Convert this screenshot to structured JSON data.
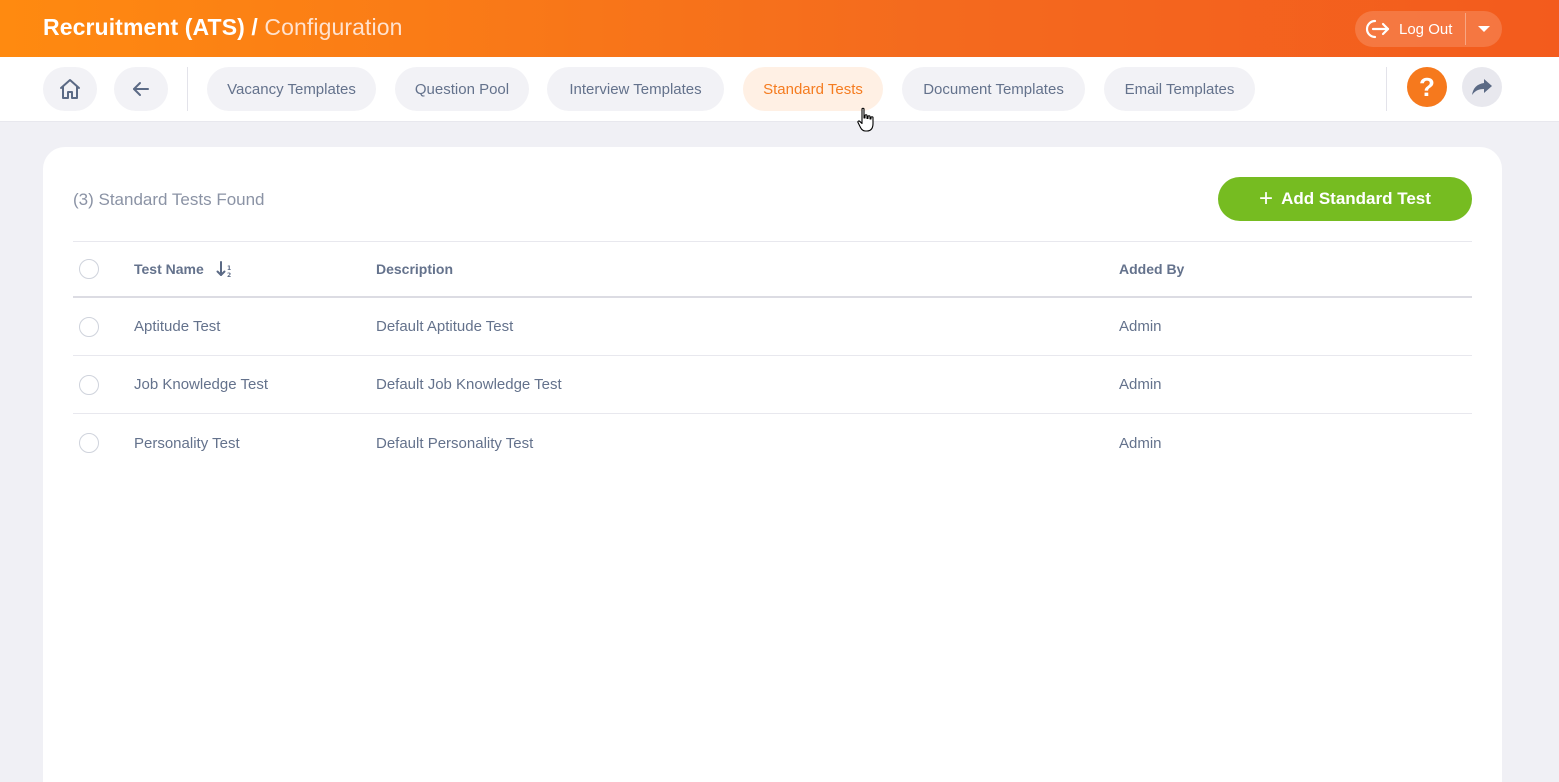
{
  "header": {
    "title_main": "Recruitment (ATS) /",
    "title_sub": "Configuration",
    "logout_label": "Log Out"
  },
  "nav": {
    "tabs": [
      {
        "label": "Vacancy Templates",
        "active": false
      },
      {
        "label": "Question Pool",
        "active": false
      },
      {
        "label": "Interview Templates",
        "active": false
      },
      {
        "label": "Standard Tests",
        "active": true
      },
      {
        "label": "Document Templates",
        "active": false
      },
      {
        "label": "Email Templates",
        "active": false
      }
    ],
    "help_label": "?"
  },
  "main": {
    "found_text": "(3) Standard Tests Found",
    "add_button_label": "Add Standard Test",
    "table": {
      "columns": [
        "Test Name",
        "Description",
        "Added By"
      ],
      "sort": {
        "column": "Test Name",
        "direction": "ascending"
      },
      "rows": [
        {
          "name": "Aptitude Test",
          "description": "Default Aptitude Test",
          "added_by": "Admin"
        },
        {
          "name": "Job Knowledge Test",
          "description": "Default Job Knowledge Test",
          "added_by": "Admin"
        },
        {
          "name": "Personality Test",
          "description": "Default Personality Test",
          "added_by": "Admin"
        }
      ]
    }
  },
  "colors": {
    "header_gradient_start": "#ff8a10",
    "header_gradient_end": "#f35b1d",
    "active_tab_text": "#f57c20",
    "add_button": "#76bc21",
    "help_button": "#f6791d"
  },
  "icons": {
    "home": "home-icon",
    "back": "arrow-left-icon",
    "logout": "logout-icon",
    "help": "question-icon",
    "share": "share-icon",
    "sort": "sort-ascending-icon",
    "add": "plus-icon"
  }
}
